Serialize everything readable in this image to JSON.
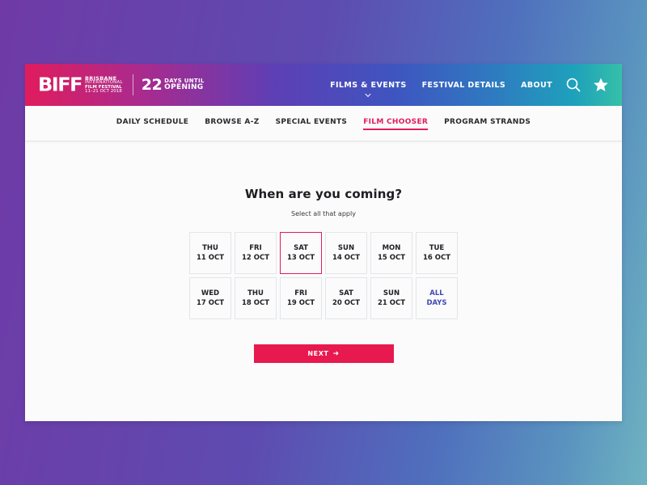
{
  "brand": {
    "logo_text": "BIFF",
    "festival_line1": "BRISBANE",
    "festival_line2": "INTERNATIONAL",
    "festival_line3": "FILM FESTIVAL",
    "festival_dates": "11–21 OCT 2018",
    "countdown_number": "22",
    "countdown_line1": "DAYS UNTIL",
    "countdown_line2": "OPENING"
  },
  "main_nav": {
    "items": [
      {
        "label": "FILMS & EVENTS",
        "has_dropdown": true
      },
      {
        "label": "FESTIVAL DETAILS"
      },
      {
        "label": "ABOUT"
      }
    ],
    "search_icon": "search-icon",
    "favourites_icon": "star-icon"
  },
  "sub_nav": {
    "items": [
      {
        "label": "DAILY SCHEDULE"
      },
      {
        "label": "BROWSE A-Z"
      },
      {
        "label": "SPECIAL EVENTS"
      },
      {
        "label": "FILM CHOOSER",
        "active": true
      },
      {
        "label": "PROGRAM STRANDS"
      }
    ]
  },
  "chooser": {
    "title": "When are you coming?",
    "subtitle": "Select all that apply",
    "days": [
      {
        "day": "THU",
        "date": "11 OCT",
        "selected": false
      },
      {
        "day": "FRI",
        "date": "12 OCT",
        "selected": false
      },
      {
        "day": "SAT",
        "date": "13 OCT",
        "selected": true
      },
      {
        "day": "SUN",
        "date": "14 OCT",
        "selected": false
      },
      {
        "day": "MON",
        "date": "15 OCT",
        "selected": false
      },
      {
        "day": "TUE",
        "date": "16 OCT",
        "selected": false
      },
      {
        "day": "WED",
        "date": "17 OCT",
        "selected": false
      },
      {
        "day": "THU",
        "date": "18 OCT",
        "selected": false
      },
      {
        "day": "FRI",
        "date": "19 OCT",
        "selected": false
      },
      {
        "day": "SAT",
        "date": "20 OCT",
        "selected": false
      },
      {
        "day": "SUN",
        "date": "21 OCT",
        "selected": false
      },
      {
        "day": "ALL",
        "date": "DAYS",
        "selected": false,
        "all_days": true
      }
    ],
    "next_label": "NEXT",
    "next_icon": "arrow-right-icon"
  },
  "colors": {
    "accent": "#e8194f",
    "all_days": "#3f4ab0",
    "text": "#222226"
  }
}
